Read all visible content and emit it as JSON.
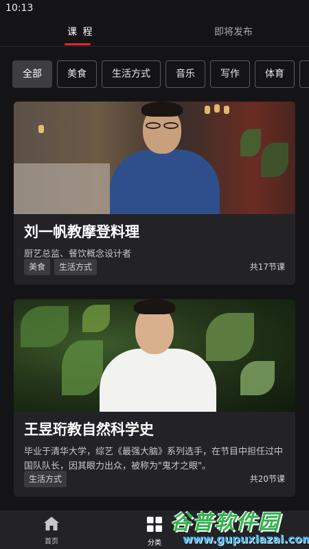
{
  "status_bar": {
    "time": "10:13"
  },
  "tabs": [
    {
      "label": "课 程",
      "active": true
    },
    {
      "label": "即将发布",
      "active": false
    }
  ],
  "accent_color": "#e02a2a",
  "filters": [
    "全部",
    "美食",
    "生活方式",
    "音乐",
    "写作",
    "体育"
  ],
  "selected_filter": "全部",
  "courses": [
    {
      "title": "刘一帆教摩登料理",
      "subtitle": "厨艺总监、餐饮概念设计者",
      "tags": [
        "美食",
        "生活方式"
      ],
      "lesson_count": "共17节课"
    },
    {
      "title": "王昱珩教自然科学史",
      "subtitle": "毕业于清华大学，综艺《最强大脑》系列选手，在节目中担任过中国队队长，因其眼力出众，被称为\"鬼才之眼\"。",
      "tags": [
        "生活方式"
      ],
      "lesson_count": "共20节课"
    }
  ],
  "bottom_nav": [
    {
      "label": "首页",
      "icon": "home-icon"
    },
    {
      "label": "分类",
      "icon": "grid-icon"
    }
  ],
  "watermark": {
    "text": "谷普软件园",
    "url": "www.gupuxiazai.com"
  }
}
